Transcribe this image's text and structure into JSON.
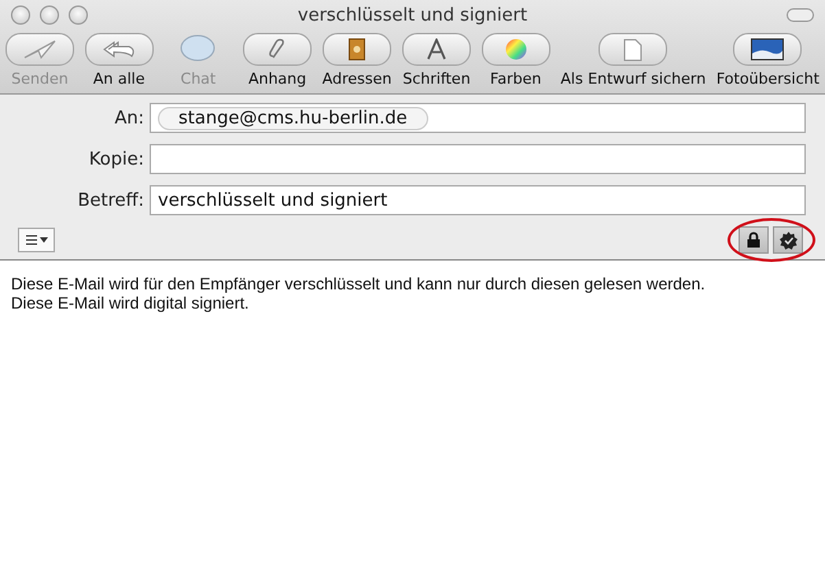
{
  "window": {
    "title": "verschlüsselt und signiert"
  },
  "toolbar": [
    {
      "kind": "send",
      "label": "Senden",
      "disabled": true
    },
    {
      "kind": "replyall",
      "label": "An alle",
      "disabled": false
    },
    {
      "kind": "chat",
      "label": "Chat",
      "disabled": true
    },
    {
      "kind": "attach",
      "label": "Anhang",
      "disabled": false
    },
    {
      "kind": "addresses",
      "label": "Adressen",
      "disabled": false
    },
    {
      "kind": "fonts",
      "label": "Schriften",
      "disabled": false
    },
    {
      "kind": "colors",
      "label": "Farben",
      "disabled": false
    },
    {
      "kind": "draft",
      "label": "Als Entwurf sichern",
      "disabled": false
    },
    {
      "kind": "photos",
      "label": "Fotoübersicht",
      "disabled": false
    }
  ],
  "header": {
    "to_label": "An:",
    "to_recipients": [
      "stange@cms.hu-berlin.de"
    ],
    "cc_label": "Kopie:",
    "subject_label": "Betreff:",
    "subject": "verschlüsselt und signiert"
  },
  "security": {
    "encrypt_on": true,
    "sign_on": true,
    "highlighted": true
  },
  "body": [
    "Diese E-Mail wird für den Empfänger verschlüsselt und kann nur durch diesen gelesen werden.",
    "Diese E-Mail wird digital signiert."
  ]
}
